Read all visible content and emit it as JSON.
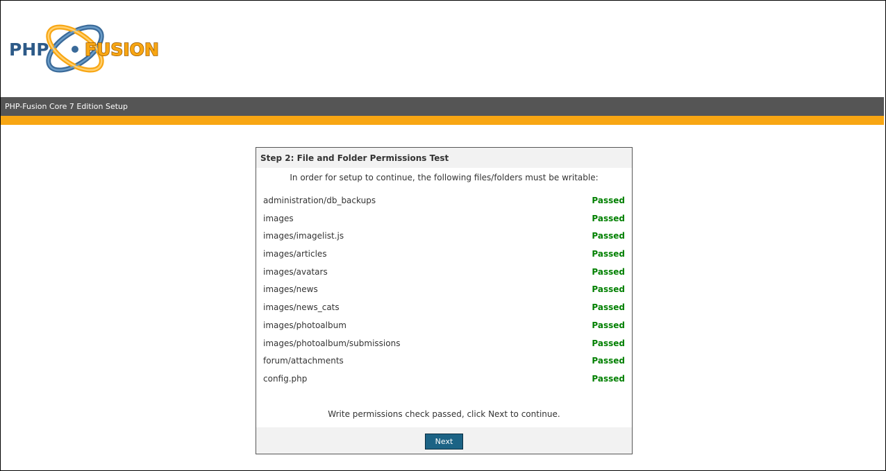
{
  "logo": {
    "text_left": "PHP",
    "text_right": "FUSION"
  },
  "header": {
    "title": "PHP-Fusion Core 7 Edition Setup"
  },
  "panel": {
    "title": "Step 2: File and Folder Permissions Test",
    "intro": "In order for setup to continue, the following files/folders must be writable:",
    "rows": [
      {
        "path": "administration/db_backups",
        "status": "Passed"
      },
      {
        "path": "images",
        "status": "Passed"
      },
      {
        "path": "images/imagelist.js",
        "status": "Passed"
      },
      {
        "path": "images/articles",
        "status": "Passed"
      },
      {
        "path": "images/avatars",
        "status": "Passed"
      },
      {
        "path": "images/news",
        "status": "Passed"
      },
      {
        "path": "images/news_cats",
        "status": "Passed"
      },
      {
        "path": "images/photoalbum",
        "status": "Passed"
      },
      {
        "path": "images/photoalbum/submissions",
        "status": "Passed"
      },
      {
        "path": "forum/attachments",
        "status": "Passed"
      },
      {
        "path": "config.php",
        "status": "Passed"
      }
    ],
    "message": "Write permissions check passed, click Next to continue.",
    "next_label": "Next"
  },
  "colors": {
    "titlebar": "#555555",
    "accent": "#f8a613",
    "passed": "#008000",
    "button": "#1c6385"
  }
}
